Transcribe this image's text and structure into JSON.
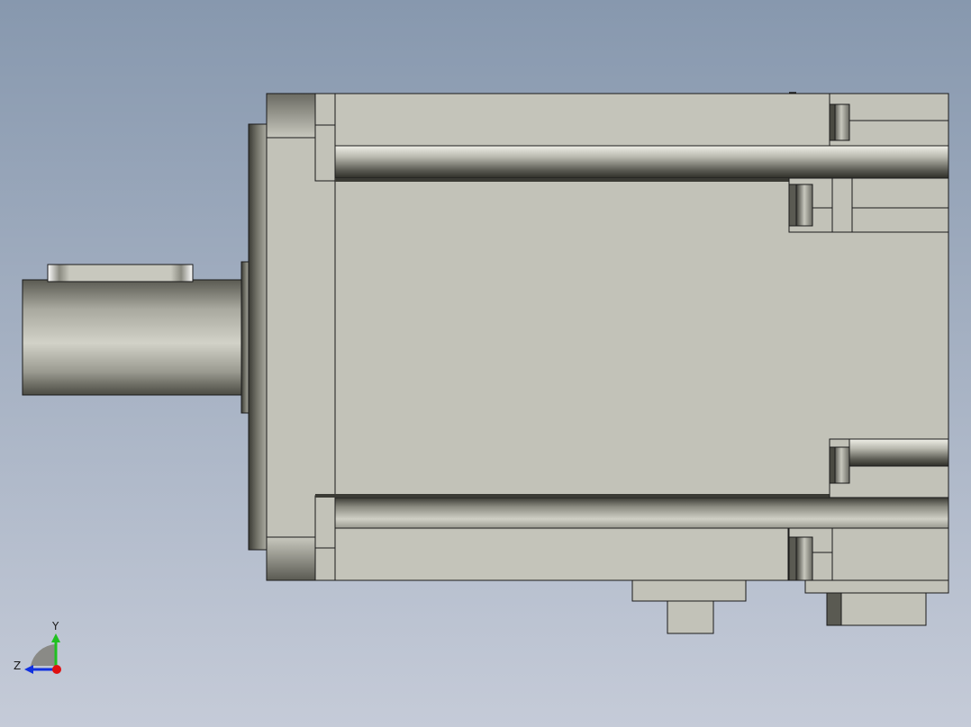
{
  "viewport": {
    "background_top": "#8798ae",
    "background_bottom": "#c5cbd8"
  },
  "model": {
    "body_color": "#c2c2b8",
    "edge_color": "#1a1a1a",
    "shaded_dark": "#4a4a44",
    "shaded_light": "#d8d8d0"
  },
  "triad": {
    "y_label": "Y",
    "z_label": "Z",
    "x_axis_color": "#e01010",
    "y_axis_color": "#20c020",
    "z_axis_color": "#1030e0"
  }
}
